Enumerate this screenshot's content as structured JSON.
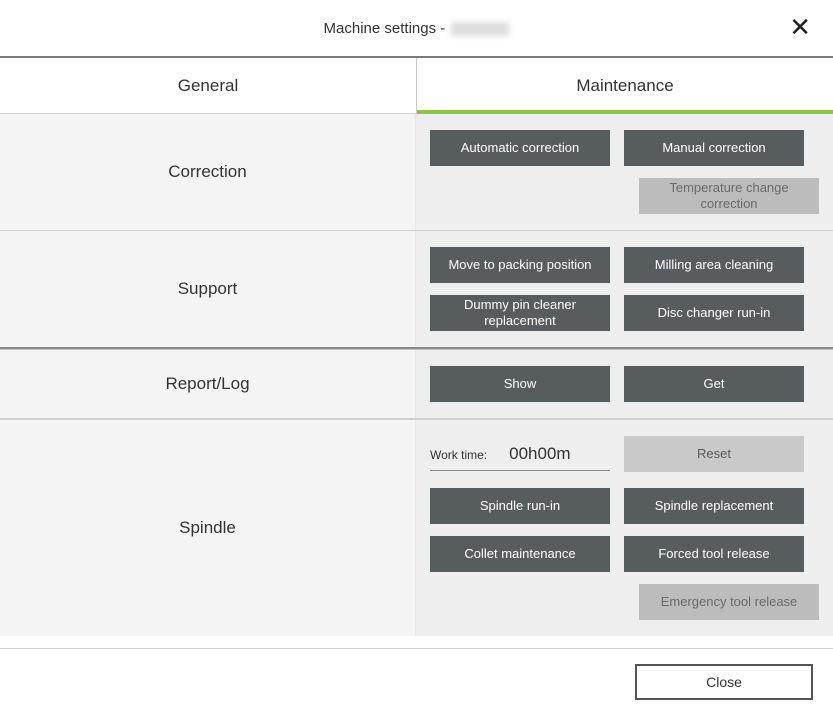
{
  "header": {
    "title_prefix": "Machine settings - "
  },
  "tabs": {
    "general": "General",
    "maintenance": "Maintenance"
  },
  "sections": {
    "correction": {
      "label": "Correction",
      "buttons": {
        "automatic": "Automatic correction",
        "manual": "Manual correction",
        "temperature": "Temperature change correction"
      }
    },
    "support": {
      "label": "Support",
      "buttons": {
        "packing": "Move to packing position",
        "milling_clean": "Milling area cleaning",
        "dummy_pin": "Dummy pin cleaner replacement",
        "disc_runin": "Disc changer run-in"
      }
    },
    "report": {
      "label": "Report/Log",
      "buttons": {
        "show": "Show",
        "get": "Get"
      }
    },
    "spindle": {
      "label": "Spindle",
      "worktime_label": "Work time:",
      "worktime_value": "00h00m",
      "buttons": {
        "reset": "Reset",
        "runin": "Spindle run-in",
        "replacement": "Spindle replacement",
        "collet": "Collet maintenance",
        "forced_release": "Forced tool release",
        "emergency_release": "Emergency tool release"
      }
    }
  },
  "footer": {
    "close": "Close"
  }
}
